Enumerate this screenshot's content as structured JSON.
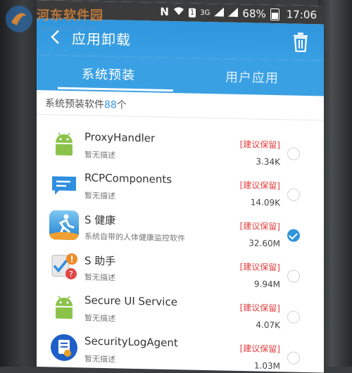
{
  "status": {
    "battery_percent": "68%",
    "time": "17:06",
    "network_label": "3G",
    "sim_label": "1",
    "notification_letter": "N"
  },
  "appbar": {
    "title": "应用卸载"
  },
  "tabs": [
    {
      "label": "系统预装",
      "active": true
    },
    {
      "label": "用户应用",
      "active": false
    }
  ],
  "summary": {
    "prefix": "系统预装软件",
    "count": "88",
    "suffix": "个"
  },
  "apps": [
    {
      "name": "ProxyHandler",
      "desc": "暂无描述",
      "tag": "[建议保留]",
      "size": "3.34K",
      "checked": false,
      "icon": "android-icon"
    },
    {
      "name": "RCPComponents",
      "desc": "暂无描述",
      "tag": "[建议保留]",
      "size": "14.09K",
      "checked": false,
      "icon": "message-bubble-icon"
    },
    {
      "name": "S 健康",
      "desc": "系统自带的人体健康监控软件",
      "tag": "[建议保留]",
      "size": "32.60M",
      "checked": true,
      "icon": "s-health-runner-icon"
    },
    {
      "name": "S 助手",
      "desc": "暂无描述",
      "tag": "[建议保留]",
      "size": "9.94M",
      "checked": false,
      "icon": "s-assistant-icon"
    },
    {
      "name": "Secure UI Service",
      "desc": "暂无描述",
      "tag": "[建议保留]",
      "size": "4.07K",
      "checked": false,
      "icon": "android-icon"
    },
    {
      "name": "SecurityLogAgent",
      "desc": "暂无描述",
      "tag": "[建议保留]",
      "size": "1.03M",
      "checked": false,
      "icon": "security-log-icon"
    }
  ],
  "watermark": {
    "text": "河东软件园",
    "url": "www.pc0359.cn"
  },
  "colors": {
    "accent": "#3aa0e4",
    "tag_red": "#e23c3c",
    "android_green": "#8bc34a"
  }
}
